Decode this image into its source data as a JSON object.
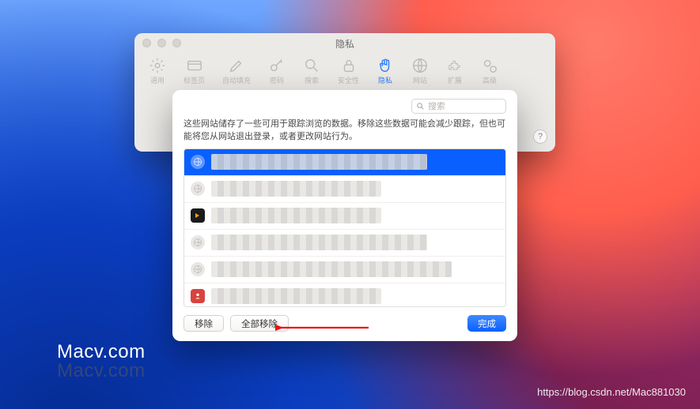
{
  "prefs": {
    "title": "隐私",
    "tabs": [
      "通用",
      "标签页",
      "自动填充",
      "密码",
      "搜索",
      "安全性",
      "隐私",
      "网站",
      "扩展",
      "高级"
    ]
  },
  "sheet": {
    "search_placeholder": "搜索",
    "description": "这些网站储存了一些可用于跟踪浏览的数据。移除这些数据可能会减少跟踪，但也可能将您从网站退出登录，或者更改网站行为。",
    "buttons": {
      "remove": "移除",
      "remove_all": "全部移除",
      "done": "完成"
    }
  },
  "overlay": {
    "watermark": "Macv.com",
    "credit": "https://blog.csdn.net/Mac881030"
  }
}
